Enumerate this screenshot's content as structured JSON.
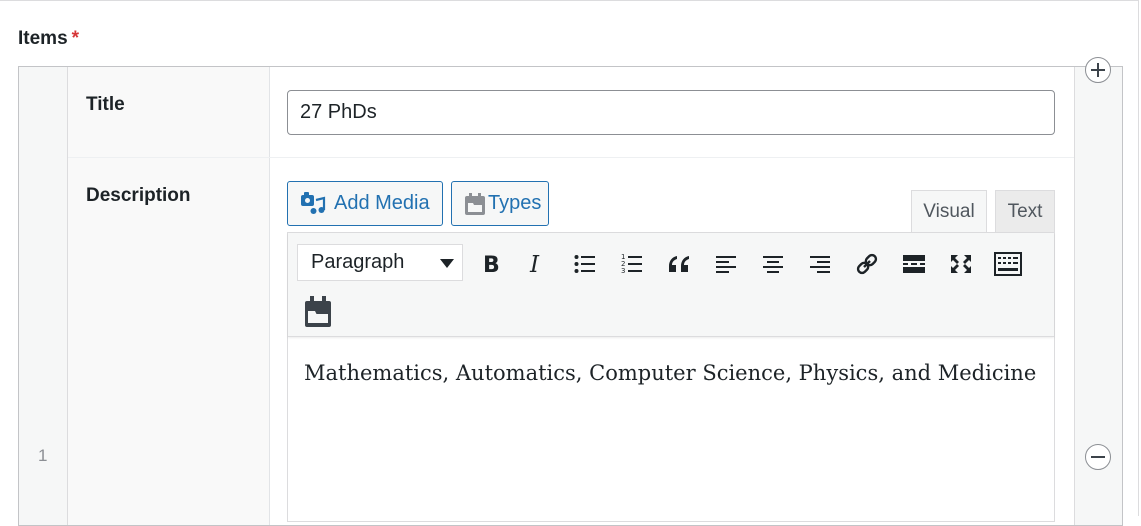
{
  "items": {
    "label": "Items",
    "required_mark": "*"
  },
  "row": {
    "number": "1",
    "title_label": "Title",
    "title_value": "27 PhDs",
    "description_label": "Description"
  },
  "buttons": {
    "add_media": "Add Media",
    "types": "Types"
  },
  "tabs": {
    "visual": "Visual",
    "text": "Text"
  },
  "toolbar": {
    "format_select": "Paragraph",
    "icons": [
      "bold-icon",
      "italic-icon",
      "bullet-list-icon",
      "numbered-list-icon",
      "blockquote-icon",
      "align-left-icon",
      "align-center-icon",
      "align-right-icon",
      "link-icon",
      "read-more-icon",
      "fullscreen-icon",
      "toolbar-toggle-icon",
      "types-calendar-icon"
    ]
  },
  "editor": {
    "content": "Mathematics, Automatics, Computer Science, Physics, and Medicine"
  },
  "colors": {
    "accent": "#2271b1",
    "required": "#d63638",
    "border": "#c3c4c7"
  }
}
